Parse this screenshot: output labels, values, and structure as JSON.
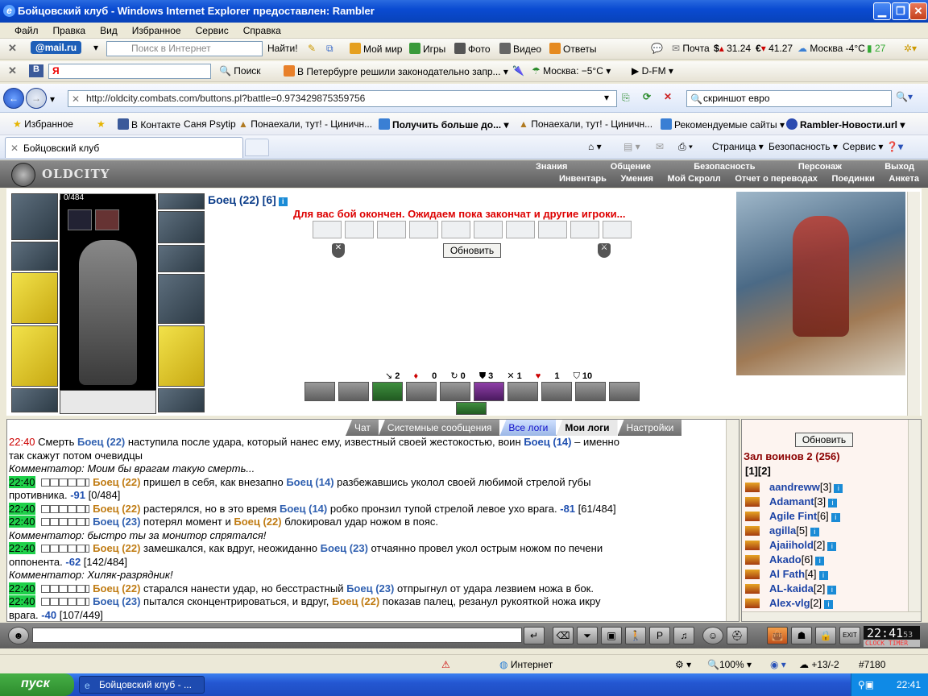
{
  "window": {
    "title": "Бойцовский клуб - Windows Internet Explorer предоставлен: Rambler"
  },
  "menu": [
    "Файл",
    "Правка",
    "Вид",
    "Избранное",
    "Сервис",
    "Справка"
  ],
  "toolbar_mail": {
    "brand": "@mail.ru",
    "search_placeholder": "Поиск в Интернет",
    "find": "Найти!",
    "items": [
      "Мой мир",
      "Игры",
      "Фото",
      "Видео",
      "Ответы"
    ],
    "mail": "Почта",
    "usd": "31.24",
    "eur": "41.27",
    "weather": "Москва -4°C",
    "count": "27"
  },
  "toolbar_yandex": {
    "brand": "Я",
    "search": "Поиск",
    "news": "В Петербурге решили законодательно запр...",
    "weather": "Москва: −5°C",
    "radio": "D-FM"
  },
  "address": {
    "url": "http://oldcity.combats.com/buttons.pl?battle=0.973429875359756",
    "search_value": "скриншот евро"
  },
  "favorites": {
    "label": "Избранное",
    "links": [
      "В Контакте",
      "Саня Psytip",
      "Понаехали, тут! - Циничн...",
      "Получить больше до...",
      "Понаехали, тут! - Циничн...",
      "Рекомендуемые сайты",
      "Rambler-Новости.url"
    ]
  },
  "tabs": {
    "active": "Бойцовский клуб",
    "tools": [
      "Страница",
      "Безопасность",
      "Сервис"
    ]
  },
  "game": {
    "logo": "OLDCITY",
    "topnav": [
      "Знания",
      "Общение",
      "Безопасность",
      "Персонаж",
      "Выход"
    ],
    "subnav": [
      "Инвентарь",
      "Умения",
      "Мой Скролл",
      "Отчет о переводах",
      "Поединки",
      "Анкета"
    ],
    "hp": "0/484",
    "opponent": "Боец (22) [6]",
    "message": "Для вас бой окончен. Ожидаем пока закончат и другие игроки...",
    "refresh": "Обновить",
    "stats": [
      "2",
      "0",
      "0",
      "3",
      "1",
      "1",
      "10"
    ]
  },
  "chat": {
    "tabs": [
      "Чат",
      "Системные сообщения",
      "Все логи",
      "Мои логи",
      "Настройки"
    ],
    "lines": [
      {
        "time": "22:40",
        "style": "r",
        "parts": [
          [
            "t",
            "Смерть "
          ],
          [
            "b",
            "Боец (22)"
          ],
          [
            "t",
            " наступила после удара, который нанес ему, известный своей жестокостью, воин "
          ],
          [
            "d",
            "Боец (14)"
          ],
          [
            "t",
            " – именно"
          ]
        ]
      },
      {
        "time": "",
        "style": "",
        "parts": [
          [
            "t",
            "так скажут потом очевидцы"
          ]
        ]
      },
      {
        "time": "",
        "style": "",
        "parts": [
          [
            "c",
            "Комментатор: Моим бы врагам такую смерть..."
          ]
        ]
      },
      {
        "time": "22:40",
        "style": "g",
        "parts": [
          [
            "m",
            ""
          ],
          [
            "o",
            "Боец (22)"
          ],
          [
            "t",
            " пришел в себя, как внезапно "
          ],
          [
            "b",
            "Боец (14)"
          ],
          [
            "t",
            " разбежавшись уколол своей любимой стрелой губы"
          ]
        ]
      },
      {
        "time": "",
        "style": "",
        "parts": [
          [
            "t",
            "противника. "
          ],
          [
            "d",
            "-91"
          ],
          [
            "t",
            " [0/484]"
          ]
        ]
      },
      {
        "time": "22:40",
        "style": "g",
        "parts": [
          [
            "m",
            ""
          ],
          [
            "o",
            "Боец (22)"
          ],
          [
            "t",
            " растерялся, но в это время "
          ],
          [
            "b",
            "Боец (14)"
          ],
          [
            "t",
            " робко пронзил тупой стрелой левое ухо врага. "
          ],
          [
            "d",
            "-81"
          ],
          [
            "t",
            " [61/484]"
          ]
        ]
      },
      {
        "time": "22:40",
        "style": "g",
        "parts": [
          [
            "m",
            ""
          ],
          [
            "b",
            "Боец (23)"
          ],
          [
            "t",
            " потерял момент и "
          ],
          [
            "o",
            "Боец (22)"
          ],
          [
            "t",
            " блокировал удар ножом в пояс."
          ]
        ]
      },
      {
        "time": "",
        "style": "",
        "parts": [
          [
            "c",
            "Комментатор: быстро ты за монитор спрятался!"
          ]
        ]
      },
      {
        "time": "22:40",
        "style": "g",
        "parts": [
          [
            "m",
            ""
          ],
          [
            "o",
            "Боец (22)"
          ],
          [
            "t",
            " замешкался, как вдруг, неожиданно "
          ],
          [
            "b",
            "Боец (23)"
          ],
          [
            "t",
            " отчаянно провел укол острым ножом по печени"
          ]
        ]
      },
      {
        "time": "",
        "style": "",
        "parts": [
          [
            "t",
            "оппонента. "
          ],
          [
            "d",
            "-62"
          ],
          [
            "t",
            " [142/484]"
          ]
        ]
      },
      {
        "time": "",
        "style": "",
        "parts": [
          [
            "c",
            "Комментатор: Хиляк-разрядник!"
          ]
        ]
      },
      {
        "time": "22:40",
        "style": "g",
        "parts": [
          [
            "m",
            ""
          ],
          [
            "o",
            "Боец (22)"
          ],
          [
            "t",
            " старался нанести удар, но бесстрастный "
          ],
          [
            "b",
            "Боец (23)"
          ],
          [
            "t",
            " отпрыгнул от удара лезвием ножа в бок."
          ]
        ]
      },
      {
        "time": "22:40",
        "style": "g",
        "parts": [
          [
            "m",
            ""
          ],
          [
            "b",
            "Боец (23)"
          ],
          [
            "t",
            " пытался сконцентрироваться, и вдруг, "
          ],
          [
            "o",
            "Боец (22)"
          ],
          [
            "t",
            " показав палец, резанул рукояткой ножа икру"
          ]
        ]
      },
      {
        "time": "",
        "style": "",
        "parts": [
          [
            "t",
            "врага. "
          ],
          [
            "d",
            "-40"
          ],
          [
            "t",
            " [107/449]"
          ]
        ]
      }
    ]
  },
  "players": {
    "refresh": "Обновить",
    "title": "Зал воинов 2 (256)",
    "pages": "[1][2]",
    "list": [
      {
        "name": "aandreww",
        "level": "[3]"
      },
      {
        "name": "Adamant",
        "level": "[3]"
      },
      {
        "name": "Agile Fint",
        "level": "[6]"
      },
      {
        "name": "agilla",
        "level": "[5]"
      },
      {
        "name": "Ajaiihold",
        "level": "[2]"
      },
      {
        "name": "Akado",
        "level": "[6]"
      },
      {
        "name": "Al Fath",
        "level": "[4]"
      },
      {
        "name": "AL-kaida",
        "level": "[2]"
      },
      {
        "name": "Alex-vlg",
        "level": "[2]"
      }
    ]
  },
  "gamebar": {
    "clock": "22:41",
    "seconds": "53",
    "clock_label": "CLOCK",
    "timer_label": "TIMER"
  },
  "status": {
    "zone": "Интернет",
    "zoom": "100%",
    "temp": "+13/-2",
    "id": "#7180"
  },
  "taskbar": {
    "start": "пуск",
    "item": "Бойцовский клуб - ...",
    "time": "22:41"
  }
}
